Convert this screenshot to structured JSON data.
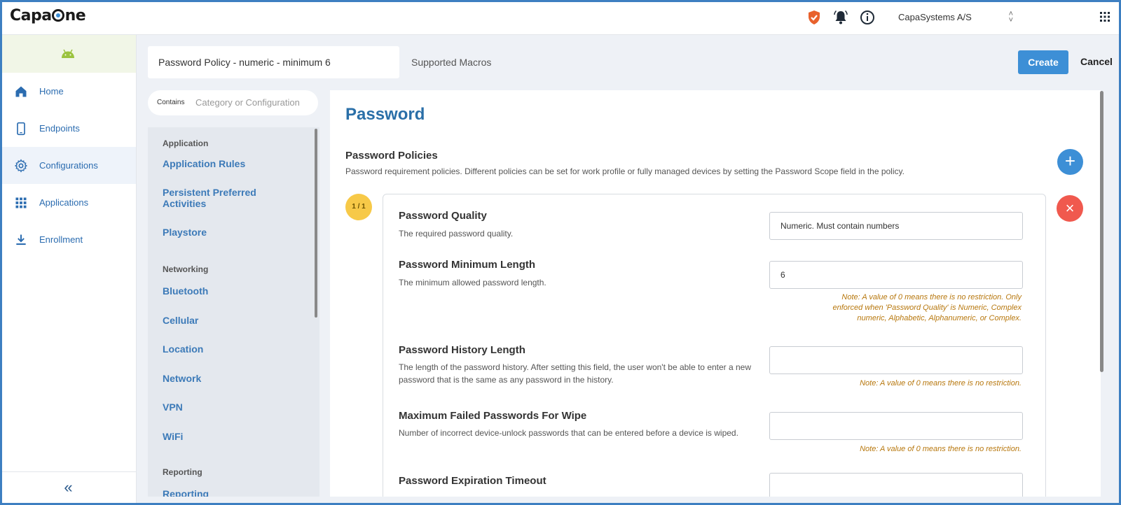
{
  "topbar": {
    "brand_pre": "Capa",
    "brand_post": "ne",
    "org": "CapaSystems A/S",
    "icons": [
      "shield-check-icon",
      "bell-icon",
      "info-icon",
      "apps-grid-icon"
    ]
  },
  "sidebar": {
    "platform_icon": "android-icon",
    "items": [
      {
        "label": "Home",
        "icon": "home-icon"
      },
      {
        "label": "Endpoints",
        "icon": "phone-icon"
      },
      {
        "label": "Configurations",
        "icon": "gear-icon",
        "active": true
      },
      {
        "label": "Applications",
        "icon": "grid-icon"
      },
      {
        "label": "Enrollment",
        "icon": "download-icon"
      }
    ],
    "collapse": "«"
  },
  "header": {
    "config_name": "Password Policy - numeric - minimum 6",
    "macros": "Supported Macros",
    "create": "Create",
    "cancel": "Cancel"
  },
  "filter": {
    "label": "Contains",
    "placeholder": "Category or Configuration"
  },
  "categories": {
    "group1": "Application",
    "g1_items": [
      "Application Rules",
      "Persistent Preferred Activities",
      "Playstore"
    ],
    "group2": "Networking",
    "g2_items": [
      "Bluetooth",
      "Cellular",
      "Location",
      "Network",
      "VPN",
      "WiFi"
    ],
    "group3": "Reporting",
    "g3_items": [
      "Reporting"
    ]
  },
  "main": {
    "title": "Password",
    "section_title": "Password Policies",
    "section_desc": "Password requirement policies. Different policies can be set for work profile or fully managed devices by setting the Password Scope field in the policy.",
    "counter": "1 / 1",
    "add": "+",
    "remove": "×",
    "fields": [
      {
        "label": "Password Quality",
        "desc": "The required password quality.",
        "value": "Numeric. Must contain numbers",
        "note": ""
      },
      {
        "label": "Password Minimum Length",
        "desc": "The minimum allowed password length.",
        "value": "6",
        "note": "Note: A value of 0 means there is no restriction. Only enforced when 'Password Quality' is Numeric, Complex numeric, Alphabetic, Alphanumeric, or Complex."
      },
      {
        "label": "Password History Length",
        "desc": "The length of the password history. After setting this field, the user won't be able to enter a new password that is the same as any password in the history.",
        "value": "",
        "note": "Note: A value of 0 means there is no restriction."
      },
      {
        "label": "Maximum Failed Passwords For Wipe",
        "desc": "Number of incorrect device-unlock passwords that can be entered before a device is wiped.",
        "value": "",
        "note": "Note: A value of 0 means there is no restriction."
      },
      {
        "label": "Password Expiration Timeout",
        "desc": "",
        "value": "",
        "note": ""
      }
    ]
  },
  "colors": {
    "accent": "#3d8fd6",
    "danger": "#f0594e",
    "note": "#b7770d",
    "badge": "#f7c948"
  }
}
